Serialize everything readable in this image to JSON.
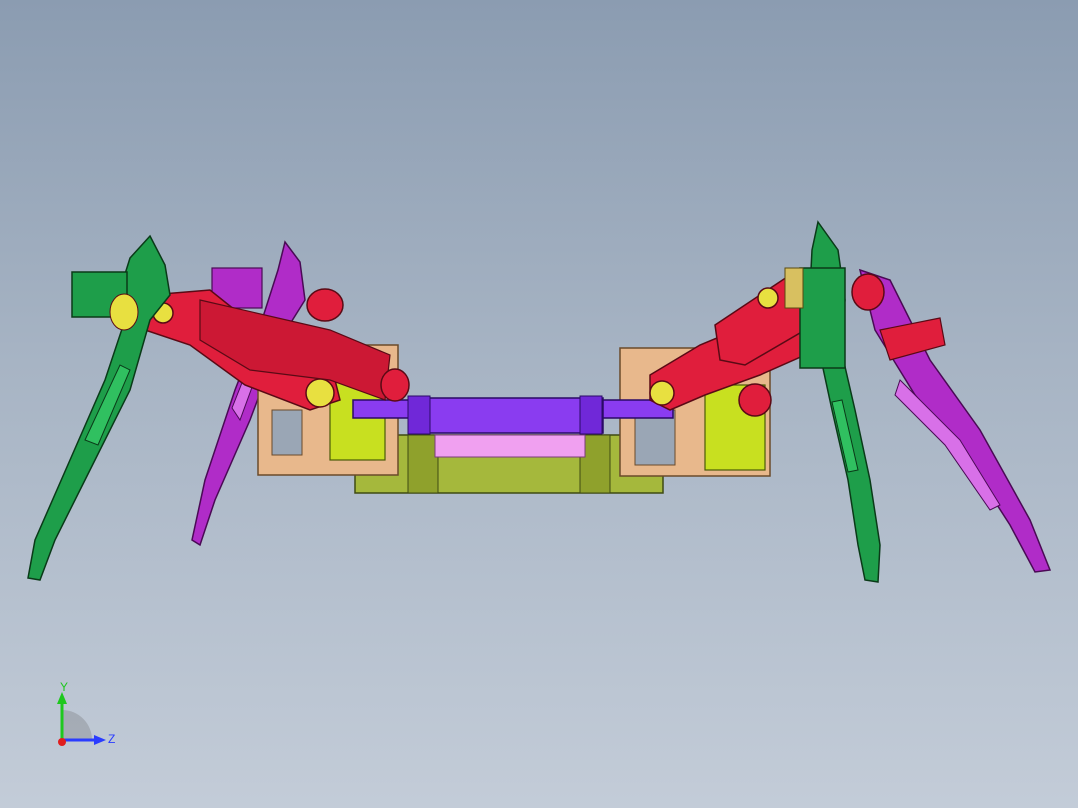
{
  "viewport": {
    "background_top": "#8b9cb1",
    "background_bottom": "#c3ccd8"
  },
  "model": {
    "parts": [
      {
        "name": "body-plate-top",
        "color": "#8a3cf0"
      },
      {
        "name": "body-plate-bottom",
        "color": "#a5b83c"
      },
      {
        "name": "servo-bracket",
        "color": "#e8b88c"
      },
      {
        "name": "coxa-link",
        "color": "#e01e3c"
      },
      {
        "name": "leg-front",
        "color": "#1e9e4a"
      },
      {
        "name": "leg-rear",
        "color": "#b02cc8"
      },
      {
        "name": "pin",
        "color": "#e8e040"
      }
    ]
  },
  "triad": {
    "y_label": "Y",
    "z_label": "Z",
    "y_color": "#1ec81e",
    "z_color": "#2a3cff",
    "x_color": "#e01e1e"
  }
}
